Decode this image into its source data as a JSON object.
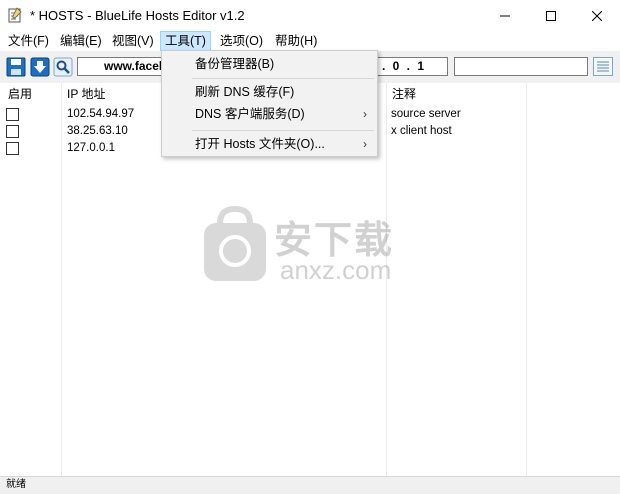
{
  "window": {
    "title": "* HOSTS - BlueLife Hosts Editor v1.2"
  },
  "menubar": {
    "items": [
      {
        "label": "文件(F)"
      },
      {
        "label": "编辑(E)"
      },
      {
        "label": "视图(V)"
      },
      {
        "label": "工具(T)"
      },
      {
        "label": "选项(O)"
      },
      {
        "label": "帮助(H)"
      }
    ]
  },
  "toolbar": {
    "host_value": "www.facel",
    "ip_value": ". 0 . 1",
    "comment_value": ""
  },
  "tools_menu": {
    "items": [
      {
        "label": "备份管理器(B)"
      },
      {
        "label": "刷新 DNS 缓存(F)"
      },
      {
        "label": "DNS 客户端服务(D)"
      },
      {
        "label": "打开 Hosts 文件夹(O)..."
      }
    ]
  },
  "list": {
    "headers": {
      "enabled": "启用",
      "ip": "IP 地址",
      "comment": "注释"
    },
    "rows": [
      {
        "ip": "102.54.94.97",
        "comment": "source server"
      },
      {
        "ip": "38.25.63.10",
        "comment": "x client host"
      },
      {
        "ip": "127.0.0.1",
        "comment": ""
      }
    ]
  },
  "watermark": {
    "cn": "安下载",
    "latin": "anxz.com"
  },
  "status": {
    "text": "就绪"
  }
}
